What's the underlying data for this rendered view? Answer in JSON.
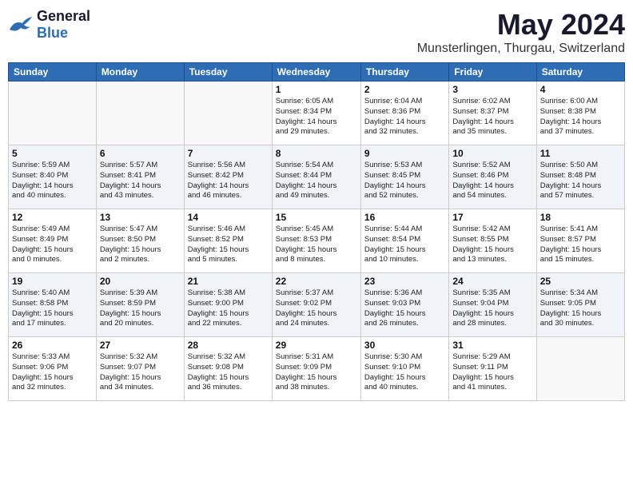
{
  "header": {
    "logo_general": "General",
    "logo_blue": "Blue",
    "month_title": "May 2024",
    "location": "Munsterlingen, Thurgau, Switzerland"
  },
  "days_of_week": [
    "Sunday",
    "Monday",
    "Tuesday",
    "Wednesday",
    "Thursday",
    "Friday",
    "Saturday"
  ],
  "weeks": [
    [
      {
        "day": "",
        "info": ""
      },
      {
        "day": "",
        "info": ""
      },
      {
        "day": "",
        "info": ""
      },
      {
        "day": "1",
        "info": "Sunrise: 6:05 AM\nSunset: 8:34 PM\nDaylight: 14 hours\nand 29 minutes."
      },
      {
        "day": "2",
        "info": "Sunrise: 6:04 AM\nSunset: 8:36 PM\nDaylight: 14 hours\nand 32 minutes."
      },
      {
        "day": "3",
        "info": "Sunrise: 6:02 AM\nSunset: 8:37 PM\nDaylight: 14 hours\nand 35 minutes."
      },
      {
        "day": "4",
        "info": "Sunrise: 6:00 AM\nSunset: 8:38 PM\nDaylight: 14 hours\nand 37 minutes."
      }
    ],
    [
      {
        "day": "5",
        "info": "Sunrise: 5:59 AM\nSunset: 8:40 PM\nDaylight: 14 hours\nand 40 minutes."
      },
      {
        "day": "6",
        "info": "Sunrise: 5:57 AM\nSunset: 8:41 PM\nDaylight: 14 hours\nand 43 minutes."
      },
      {
        "day": "7",
        "info": "Sunrise: 5:56 AM\nSunset: 8:42 PM\nDaylight: 14 hours\nand 46 minutes."
      },
      {
        "day": "8",
        "info": "Sunrise: 5:54 AM\nSunset: 8:44 PM\nDaylight: 14 hours\nand 49 minutes."
      },
      {
        "day": "9",
        "info": "Sunrise: 5:53 AM\nSunset: 8:45 PM\nDaylight: 14 hours\nand 52 minutes."
      },
      {
        "day": "10",
        "info": "Sunrise: 5:52 AM\nSunset: 8:46 PM\nDaylight: 14 hours\nand 54 minutes."
      },
      {
        "day": "11",
        "info": "Sunrise: 5:50 AM\nSunset: 8:48 PM\nDaylight: 14 hours\nand 57 minutes."
      }
    ],
    [
      {
        "day": "12",
        "info": "Sunrise: 5:49 AM\nSunset: 8:49 PM\nDaylight: 15 hours\nand 0 minutes."
      },
      {
        "day": "13",
        "info": "Sunrise: 5:47 AM\nSunset: 8:50 PM\nDaylight: 15 hours\nand 2 minutes."
      },
      {
        "day": "14",
        "info": "Sunrise: 5:46 AM\nSunset: 8:52 PM\nDaylight: 15 hours\nand 5 minutes."
      },
      {
        "day": "15",
        "info": "Sunrise: 5:45 AM\nSunset: 8:53 PM\nDaylight: 15 hours\nand 8 minutes."
      },
      {
        "day": "16",
        "info": "Sunrise: 5:44 AM\nSunset: 8:54 PM\nDaylight: 15 hours\nand 10 minutes."
      },
      {
        "day": "17",
        "info": "Sunrise: 5:42 AM\nSunset: 8:55 PM\nDaylight: 15 hours\nand 13 minutes."
      },
      {
        "day": "18",
        "info": "Sunrise: 5:41 AM\nSunset: 8:57 PM\nDaylight: 15 hours\nand 15 minutes."
      }
    ],
    [
      {
        "day": "19",
        "info": "Sunrise: 5:40 AM\nSunset: 8:58 PM\nDaylight: 15 hours\nand 17 minutes."
      },
      {
        "day": "20",
        "info": "Sunrise: 5:39 AM\nSunset: 8:59 PM\nDaylight: 15 hours\nand 20 minutes."
      },
      {
        "day": "21",
        "info": "Sunrise: 5:38 AM\nSunset: 9:00 PM\nDaylight: 15 hours\nand 22 minutes."
      },
      {
        "day": "22",
        "info": "Sunrise: 5:37 AM\nSunset: 9:02 PM\nDaylight: 15 hours\nand 24 minutes."
      },
      {
        "day": "23",
        "info": "Sunrise: 5:36 AM\nSunset: 9:03 PM\nDaylight: 15 hours\nand 26 minutes."
      },
      {
        "day": "24",
        "info": "Sunrise: 5:35 AM\nSunset: 9:04 PM\nDaylight: 15 hours\nand 28 minutes."
      },
      {
        "day": "25",
        "info": "Sunrise: 5:34 AM\nSunset: 9:05 PM\nDaylight: 15 hours\nand 30 minutes."
      }
    ],
    [
      {
        "day": "26",
        "info": "Sunrise: 5:33 AM\nSunset: 9:06 PM\nDaylight: 15 hours\nand 32 minutes."
      },
      {
        "day": "27",
        "info": "Sunrise: 5:32 AM\nSunset: 9:07 PM\nDaylight: 15 hours\nand 34 minutes."
      },
      {
        "day": "28",
        "info": "Sunrise: 5:32 AM\nSunset: 9:08 PM\nDaylight: 15 hours\nand 36 minutes."
      },
      {
        "day": "29",
        "info": "Sunrise: 5:31 AM\nSunset: 9:09 PM\nDaylight: 15 hours\nand 38 minutes."
      },
      {
        "day": "30",
        "info": "Sunrise: 5:30 AM\nSunset: 9:10 PM\nDaylight: 15 hours\nand 40 minutes."
      },
      {
        "day": "31",
        "info": "Sunrise: 5:29 AM\nSunset: 9:11 PM\nDaylight: 15 hours\nand 41 minutes."
      },
      {
        "day": "",
        "info": ""
      }
    ]
  ]
}
